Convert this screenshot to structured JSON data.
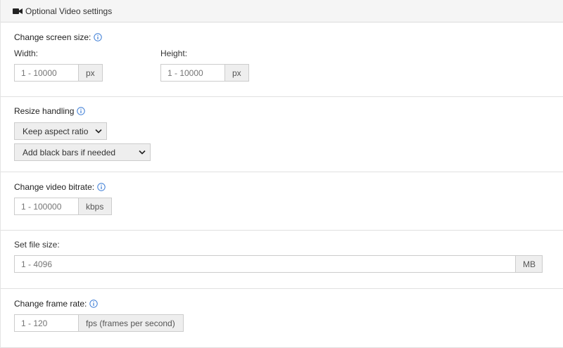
{
  "header": {
    "title": "Optional Video settings",
    "icon": "video-camera-icon"
  },
  "screen_size": {
    "label": "Change screen size:",
    "width": {
      "label": "Width:",
      "placeholder": "1 - 10000",
      "unit": "px"
    },
    "height": {
      "label": "Height:",
      "placeholder": "1 - 10000",
      "unit": "px"
    }
  },
  "resize": {
    "label": "Resize handling",
    "aspect_select": "Keep aspect ratio",
    "bars_select": "Add black bars if needed"
  },
  "bitrate": {
    "label": "Change video bitrate:",
    "placeholder": "1 - 100000",
    "unit": "kbps"
  },
  "file_size": {
    "label": "Set file size:",
    "placeholder": "1 - 4096",
    "unit": "MB"
  },
  "frame_rate": {
    "label": "Change frame rate:",
    "placeholder": "1 - 120",
    "unit": "fps (frames per second)"
  },
  "colors": {
    "info_icon": "#3a7bd5",
    "addon_bg": "#eeeeee",
    "border": "#cccccc"
  }
}
